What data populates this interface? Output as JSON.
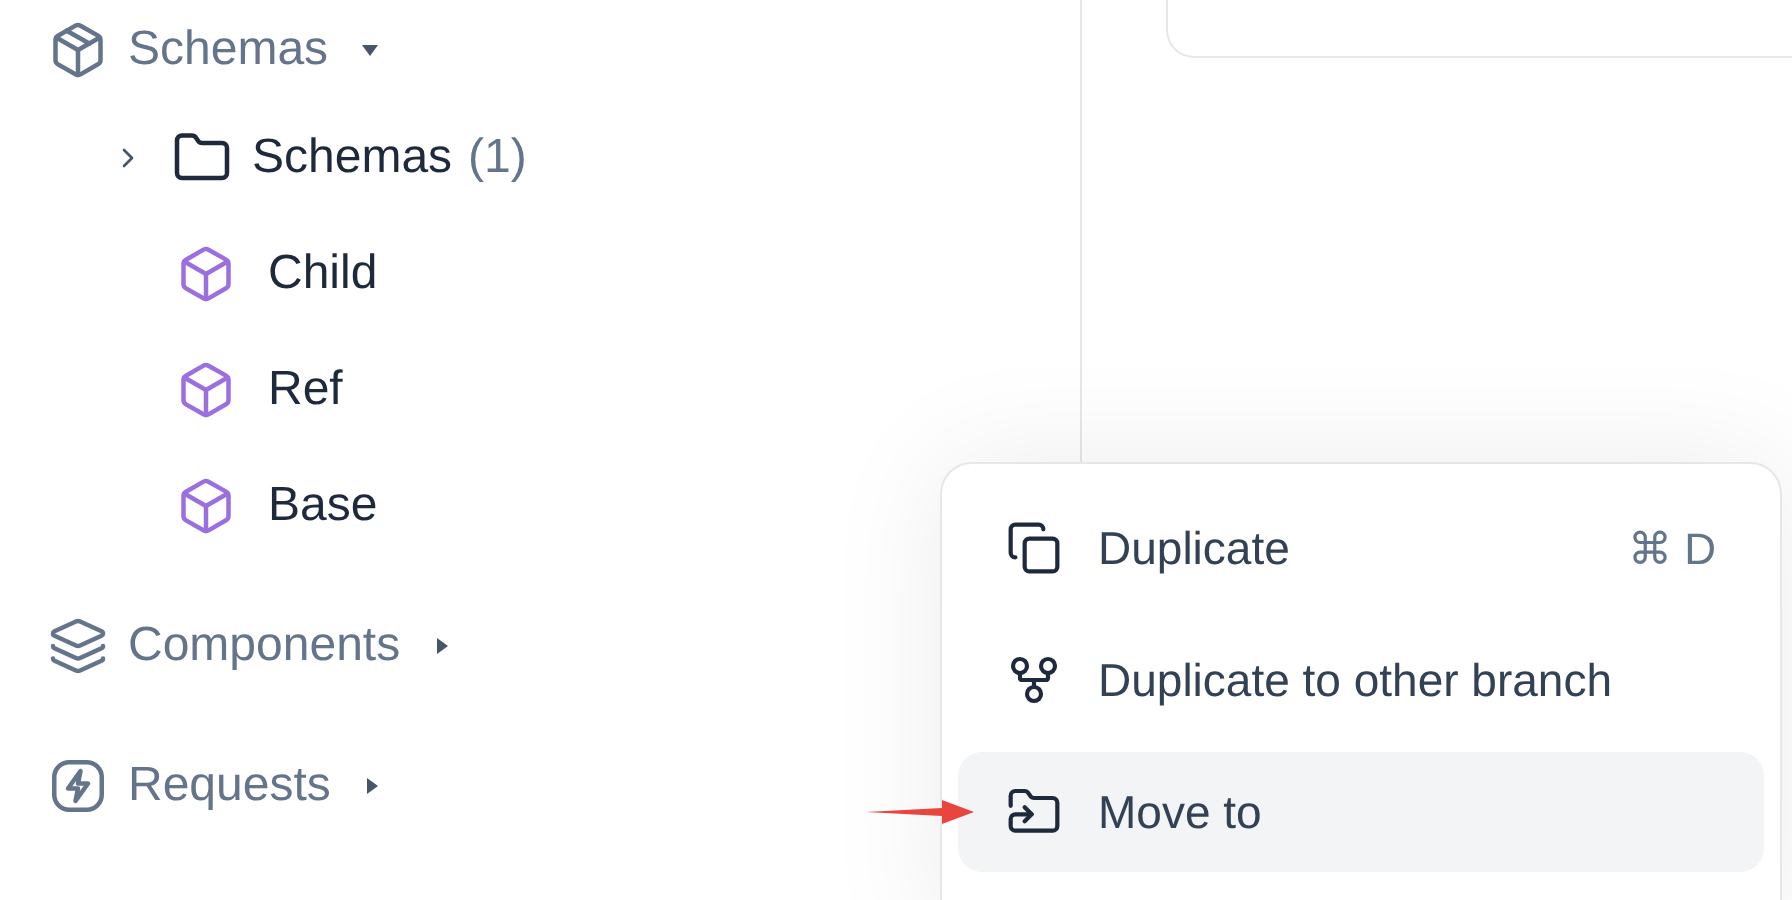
{
  "sidebar": {
    "sections": [
      {
        "label": "Schemas",
        "expanded": true,
        "children": [
          {
            "kind": "folder",
            "label": "Schemas",
            "count": "(1)",
            "expanded": false
          },
          {
            "kind": "schema",
            "label": "Child"
          },
          {
            "kind": "schema",
            "label": "Ref"
          },
          {
            "kind": "schema",
            "label": "Base"
          }
        ]
      },
      {
        "label": "Components",
        "expanded": false
      },
      {
        "label": "Requests",
        "expanded": false
      }
    ]
  },
  "context_menu": {
    "items": [
      {
        "label": "Duplicate",
        "shortcut": "⌘ D",
        "selected": false
      },
      {
        "label": "Duplicate to other branch",
        "selected": false
      },
      {
        "label": "Move to",
        "selected": true
      }
    ]
  }
}
